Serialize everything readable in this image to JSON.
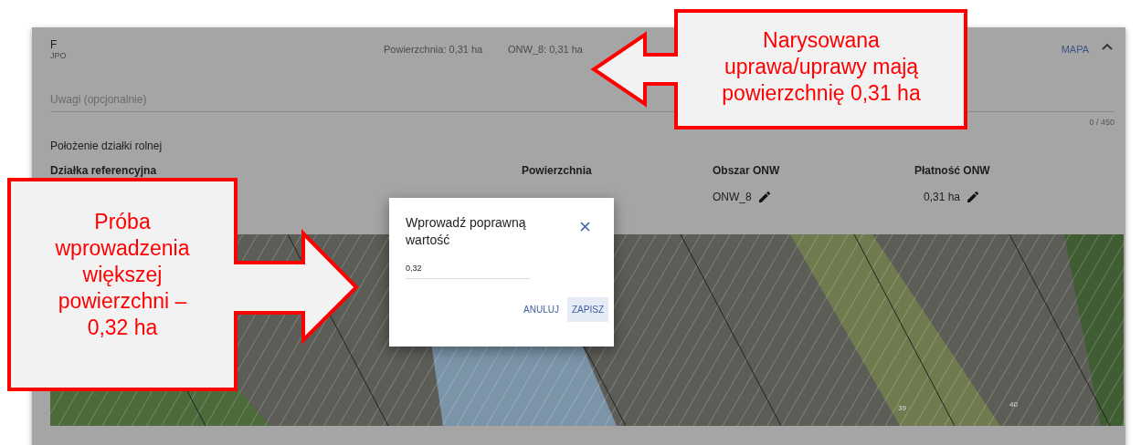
{
  "panel": {
    "title": "F",
    "subtitle": "JPO",
    "area_summary": "Powierzchnia: 0,31 ha",
    "onw_summary": "ONW_8: 0,31 ha",
    "map_link": "MAPA",
    "expanded": true
  },
  "notes_field": {
    "placeholder": "Uwagi (opcjonalnie)",
    "counter": "0 / 450"
  },
  "location": {
    "heading": "Położenie działki rolnej",
    "columns": [
      "Działka referencyjna",
      "Powierzchnia",
      "Obszar ONW",
      "Płatność ONW"
    ],
    "row": {
      "onw_area": "ONW_8",
      "onw_payment": "0,31 ha"
    }
  },
  "map": {
    "labels": [
      "39",
      "40"
    ]
  },
  "dialog": {
    "title": "Wprowadź poprawną wartość",
    "value": "0,32",
    "buttons": [
      {
        "label": "ANULUJ",
        "selected": false
      },
      {
        "label": "ZAPISZ",
        "selected": true
      }
    ]
  },
  "callouts": [
    {
      "text": "Narysowana\nuprawa/uprawy mają\npowierzchnię 0,31 ha"
    },
    {
      "text": "Próba\nwprowadzenia\nwiększej\npowierzchni –\n0,32 ha"
    }
  ]
}
